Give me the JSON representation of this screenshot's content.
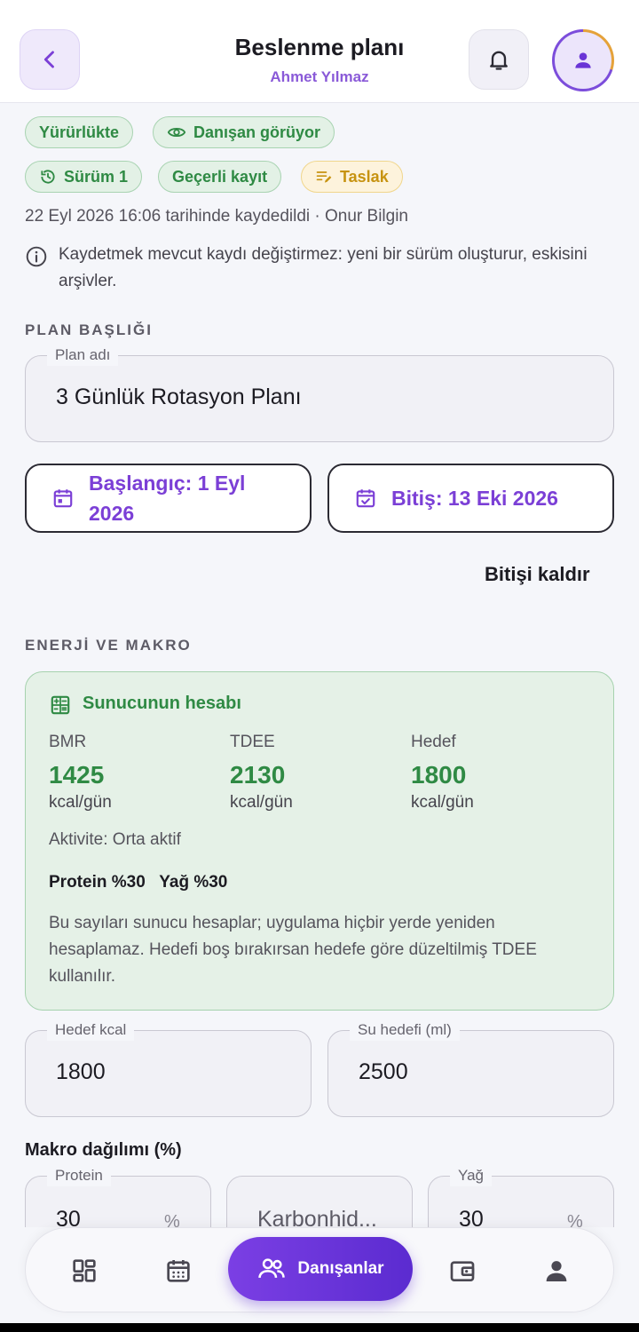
{
  "header": {
    "title": "Beslenme planı",
    "subtitle": "Ahmet Yılmaz",
    "icons": {
      "back": "chevron-left-icon",
      "notifications": "bell-icon",
      "profile": "user-icon"
    }
  },
  "chips": {
    "active": "Yürürlükte",
    "visible": "Danışan görüyor",
    "version": "Sürüm 1",
    "valid": "Geçerli kayıt",
    "draft": "Taslak"
  },
  "meta": "22 Eyl 2026 16:06 tarihinde kaydedildi · Onur Bilgin",
  "info_note": "Kaydetmek mevcut kaydı değiştirmez: yeni bir sürüm oluşturur, eskisini arşivler.",
  "plan_section": {
    "heading": "PLAN BAŞLIĞI",
    "name_label": "Plan adı",
    "name_value": "3 Günlük Rotasyon Planı",
    "start_date": "Başlangıç: 1 Eyl 2026",
    "end_date": "Bitiş: 13 Eki 2026",
    "remove_end": "Bitişi kaldır"
  },
  "energy_section": {
    "heading": "ENERJİ VE MAKRO",
    "card_title": "Sunucunun hesabı",
    "stats": [
      {
        "label": "BMR",
        "value": "1425",
        "unit": "kcal/gün"
      },
      {
        "label": "TDEE",
        "value": "2130",
        "unit": "kcal/gün"
      },
      {
        "label": "Hedef",
        "value": "1800",
        "unit": "kcal/gün"
      }
    ],
    "activity": "Aktivite: Orta aktif",
    "macros_summary": "Protein %30   Yağ %30",
    "note": "Bu sayıları sunucu hesaplar; uygulama hiçbir yerde yeniden hesaplamaz. Hedefi boş bırakırsan hedefe göre düzeltilmiş TDEE kullanılır.",
    "target_kcal_label": "Hedef kcal",
    "target_kcal_value": "1800",
    "water_label": "Su hedefi (ml)",
    "water_value": "2500"
  },
  "macro_split": {
    "heading": "Makro dağılımı (%)",
    "protein_label": "Protein",
    "protein_value": "30",
    "carb_placeholder": "Karbonhid...",
    "fat_label": "Yağ",
    "fat_value": "30",
    "unit": "%"
  },
  "bottom_nav": {
    "active_label": "Danışanlar",
    "icons": [
      "dashboard-icon",
      "calendar-icon",
      "clients-icon",
      "wallet-icon",
      "profile-icon"
    ]
  },
  "colors": {
    "accent": "#7b3fd6",
    "success": "#2f8a44",
    "warning": "#c79311"
  }
}
